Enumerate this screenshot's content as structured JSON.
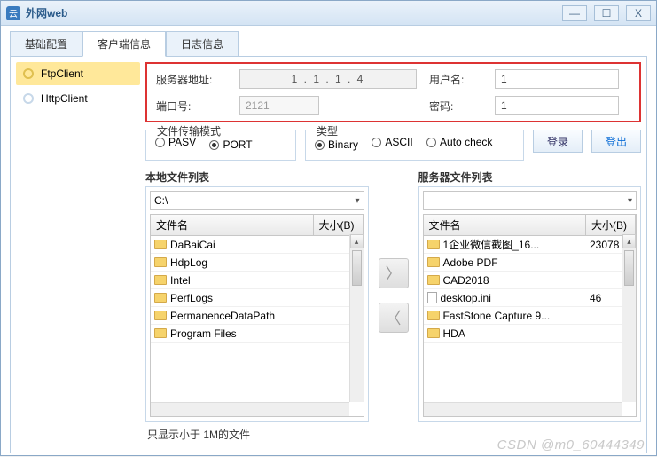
{
  "window": {
    "title": "外网web"
  },
  "winbtns": {
    "min": "—",
    "max": "☐",
    "close": "X"
  },
  "tabs": [
    "基础配置",
    "客户端信息",
    "日志信息"
  ],
  "activeTab": 1,
  "sidebar": {
    "items": [
      {
        "label": "FtpClient",
        "active": true
      },
      {
        "label": "HttpClient",
        "active": false
      }
    ]
  },
  "conn": {
    "serverLabel": "服务器地址:",
    "serverValue": "1 . 1 . 1 . 4",
    "portLabel": "端口号:",
    "portValue": "2121",
    "userLabel": "用户名:",
    "userValue": "1",
    "passLabel": "密码:",
    "passValue": "1"
  },
  "modeGroup": {
    "legend": "文件传输模式",
    "options": [
      {
        "label": "PASV",
        "checked": false
      },
      {
        "label": "PORT",
        "checked": true
      }
    ]
  },
  "typeGroup": {
    "legend": "类型",
    "options": [
      {
        "label": "Binary",
        "checked": true
      },
      {
        "label": "ASCII",
        "checked": false
      },
      {
        "label": "Auto check",
        "checked": false
      }
    ]
  },
  "actions": {
    "login": "登录",
    "logout": "登出"
  },
  "local": {
    "legend": "本地文件列表",
    "drive": "C:\\",
    "cols": {
      "name": "文件名",
      "size": "大小(B)"
    },
    "rows": [
      {
        "name": "DaBaiCai",
        "type": "folder",
        "size": ""
      },
      {
        "name": "HdpLog",
        "type": "folder",
        "size": ""
      },
      {
        "name": "Intel",
        "type": "folder",
        "size": ""
      },
      {
        "name": "PerfLogs",
        "type": "folder",
        "size": ""
      },
      {
        "name": "PermanenceDataPath",
        "type": "folder",
        "size": ""
      },
      {
        "name": "Program Files",
        "type": "folder",
        "size": ""
      }
    ]
  },
  "remote": {
    "legend": "服务器文件列表",
    "drive": "",
    "cols": {
      "name": "文件名",
      "size": "大小(B)"
    },
    "rows": [
      {
        "name": "1企业微信截图_16...",
        "type": "folder",
        "size": "23078"
      },
      {
        "name": "Adobe PDF",
        "type": "folder",
        "size": ""
      },
      {
        "name": "CAD2018",
        "type": "folder",
        "size": ""
      },
      {
        "name": "desktop.ini",
        "type": "file",
        "size": "46"
      },
      {
        "name": "FastStone Capture 9...",
        "type": "folder",
        "size": ""
      },
      {
        "name": "HDA",
        "type": "folder",
        "size": ""
      }
    ]
  },
  "footer": "只显示小于 1M的文件",
  "watermark": "CSDN @m0_60444349"
}
